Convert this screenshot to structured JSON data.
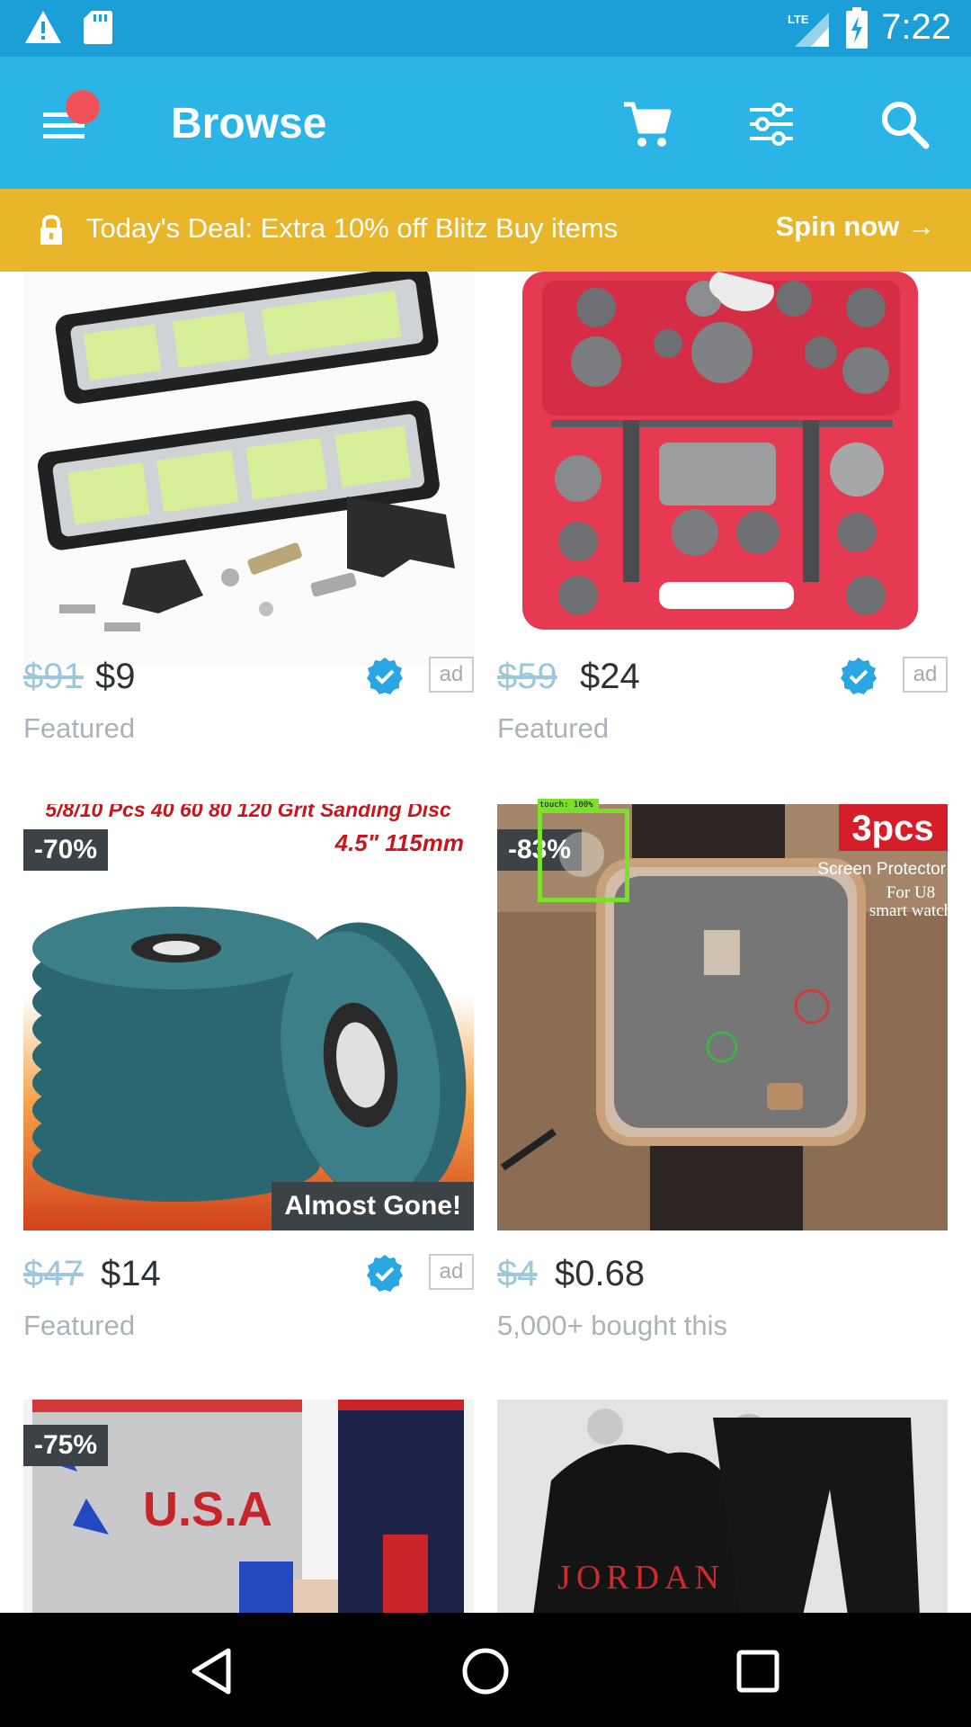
{
  "status_bar": {
    "time": "7:22",
    "network": "LTE",
    "icons": [
      "alert-icon",
      "sd-card-icon",
      "signal-icon",
      "battery-charging-icon"
    ]
  },
  "app_bar": {
    "title": "Browse",
    "icons": [
      "menu-icon",
      "cart-icon",
      "filter-icon",
      "search-icon"
    ],
    "colors": {
      "bar": "#2bb5e6",
      "status": "#1b9fd6",
      "notification_dot": "#f0525a"
    }
  },
  "deal_banner": {
    "text": "Today's Deal: Extra 10% off Blitz Buy items",
    "cta": "Spin now →",
    "color": "#e9b52b"
  },
  "products": [
    {
      "old_price": "$91",
      "new_price": "$9",
      "subtitle": "Featured",
      "verified": true,
      "ad": "ad",
      "badge": ""
    },
    {
      "old_price": "$59",
      "new_price": "$24",
      "subtitle": "Featured",
      "verified": true,
      "ad": "ad",
      "badge": ""
    },
    {
      "old_price": "$47",
      "new_price": "$14",
      "subtitle": "Featured",
      "verified": true,
      "ad": "ad",
      "badge": "-70%",
      "corner_badge": "Almost Gone!",
      "image_caption_1": "5/8/10 Pcs 40 60 80 120 Grit Sanding Disc",
      "image_caption_2": "4.5\" 115mm"
    },
    {
      "old_price": "$4",
      "new_price": "$0.68",
      "subtitle": "5,000+ bought this",
      "verified": false,
      "badge": "-83%",
      "image_tag_1": "3pcs",
      "image_tag_2": "Screen Protector",
      "image_tag_3": "For U8",
      "image_tag_4": "smart watch"
    },
    {
      "badge": "-75%",
      "image_text": "U.S.A"
    },
    {
      "image_text": "JORDAN"
    }
  ],
  "touch_overlay": {
    "label": "touch: 100%"
  },
  "nav_bar": {
    "icons": [
      "back-icon",
      "home-icon",
      "recents-icon"
    ]
  }
}
